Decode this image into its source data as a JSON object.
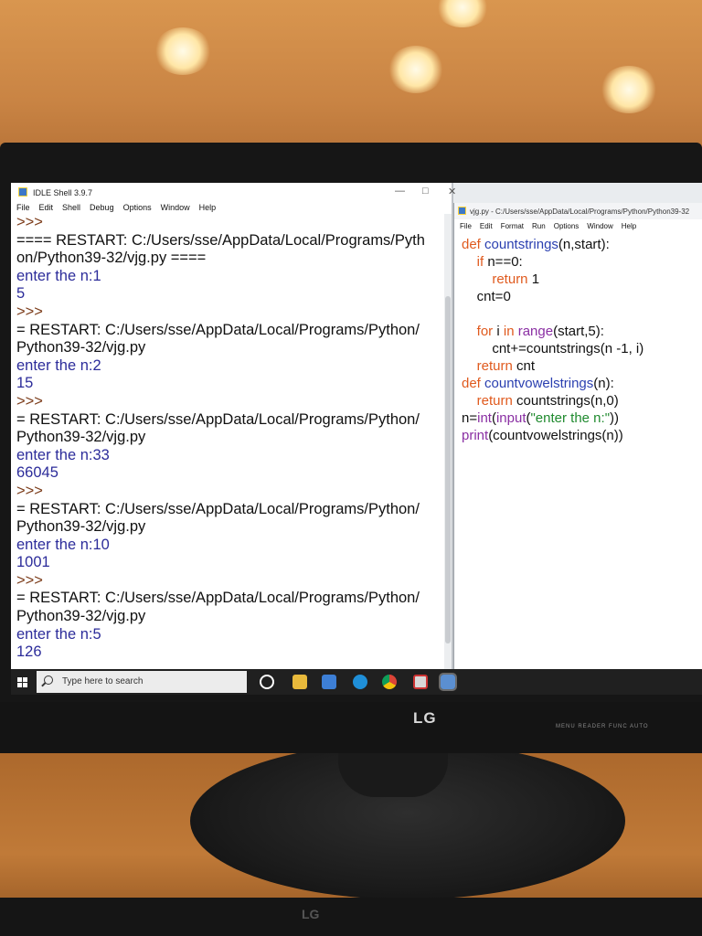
{
  "shell": {
    "title": "IDLE Shell 3.9.7",
    "menu": [
      "File",
      "Edit",
      "Shell",
      "Debug",
      "Options",
      "Window",
      "Help"
    ],
    "lines": [
      {
        "kind": "prompt",
        "text": ">>>"
      },
      {
        "kind": "restart",
        "text": "==== RESTART: C:/Users/sse/AppData/Local/Programs/Pyth"
      },
      {
        "kind": "restart",
        "text": "on/Python39-32/vjg.py ===="
      },
      {
        "kind": "input-label",
        "text": "enter the n:1"
      },
      {
        "kind": "output",
        "text": "5"
      },
      {
        "kind": "prompt",
        "text": ">>>"
      },
      {
        "kind": "restart",
        "text": "= RESTART: C:/Users/sse/AppData/Local/Programs/Python/"
      },
      {
        "kind": "restart",
        "text": "Python39-32/vjg.py"
      },
      {
        "kind": "input-label",
        "text": "enter the n:2"
      },
      {
        "kind": "output",
        "text": "15"
      },
      {
        "kind": "prompt",
        "text": ">>>"
      },
      {
        "kind": "restart",
        "text": "= RESTART: C:/Users/sse/AppData/Local/Programs/Python/"
      },
      {
        "kind": "restart",
        "text": "Python39-32/vjg.py"
      },
      {
        "kind": "input-label",
        "text": "enter the n:33"
      },
      {
        "kind": "output",
        "text": "66045"
      },
      {
        "kind": "prompt",
        "text": ">>>"
      },
      {
        "kind": "restart",
        "text": "= RESTART: C:/Users/sse/AppData/Local/Programs/Python/"
      },
      {
        "kind": "restart",
        "text": "Python39-32/vjg.py"
      },
      {
        "kind": "input-label",
        "text": "enter the n:10"
      },
      {
        "kind": "output",
        "text": "1001"
      },
      {
        "kind": "prompt",
        "text": ">>>"
      },
      {
        "kind": "restart",
        "text": "= RESTART: C:/Users/sse/AppData/Local/Programs/Python/"
      },
      {
        "kind": "restart",
        "text": "Python39-32/vjg.py"
      },
      {
        "kind": "input-label",
        "text": "enter the n:5"
      },
      {
        "kind": "output",
        "text": "126"
      }
    ]
  },
  "editor": {
    "title": "vjg.py - C:/Users/sse/AppData/Local/Programs/Python/Python39-32",
    "menu": [
      "File",
      "Edit",
      "Format",
      "Run",
      "Options",
      "Window",
      "Help"
    ],
    "code": [
      [
        {
          "t": "def",
          "c": "kw"
        },
        {
          "t": " "
        },
        {
          "t": "countstrings",
          "c": "def"
        },
        {
          "t": "(n,start):"
        }
      ],
      [
        {
          "t": "    "
        },
        {
          "t": "if",
          "c": "kw"
        },
        {
          "t": " n==0:"
        }
      ],
      [
        {
          "t": "        "
        },
        {
          "t": "return",
          "c": "kw"
        },
        {
          "t": " 1"
        }
      ],
      [
        {
          "t": "    cnt=0"
        }
      ],
      [
        {
          "t": ""
        }
      ],
      [
        {
          "t": "    "
        },
        {
          "t": "for",
          "c": "kw"
        },
        {
          "t": " i "
        },
        {
          "t": "in",
          "c": "kw"
        },
        {
          "t": " "
        },
        {
          "t": "range",
          "c": "bi"
        },
        {
          "t": "(start,5):"
        }
      ],
      [
        {
          "t": "        cnt+=countstrings(n -1, i)"
        }
      ],
      [
        {
          "t": "    "
        },
        {
          "t": "return",
          "c": "kw"
        },
        {
          "t": " cnt"
        }
      ],
      [
        {
          "t": "def",
          "c": "kw"
        },
        {
          "t": " "
        },
        {
          "t": "countvowelstrings",
          "c": "def"
        },
        {
          "t": "(n):"
        }
      ],
      [
        {
          "t": "    "
        },
        {
          "t": "return",
          "c": "kw"
        },
        {
          "t": " countstrings(n,0)"
        }
      ],
      [
        {
          "t": "n="
        },
        {
          "t": "int",
          "c": "bi"
        },
        {
          "t": "("
        },
        {
          "t": "input",
          "c": "bi"
        },
        {
          "t": "("
        },
        {
          "t": "\"enter the n:\"",
          "c": "str"
        },
        {
          "t": "))"
        }
      ],
      [
        {
          "t": "print",
          "c": "bi"
        },
        {
          "t": "(countvowelstrings(n))"
        }
      ]
    ]
  },
  "taskbar": {
    "search_placeholder": "Type here to search"
  },
  "monitor": {
    "brand": "LG",
    "button_labels": "MENU   READER   FUNC   AUTO"
  },
  "colors": {
    "keyword": "#e05a1e",
    "def_name": "#2a3fb0",
    "string": "#1f8a2e",
    "builtin": "#8a2fa3",
    "shell_output": "#2c2c9a"
  },
  "icons": [
    "windows-start-icon",
    "search-icon",
    "cortana-icon",
    "file-explorer-icon",
    "store-icon",
    "edge-icon",
    "chrome-icon",
    "app-icon",
    "idle-icon"
  ]
}
